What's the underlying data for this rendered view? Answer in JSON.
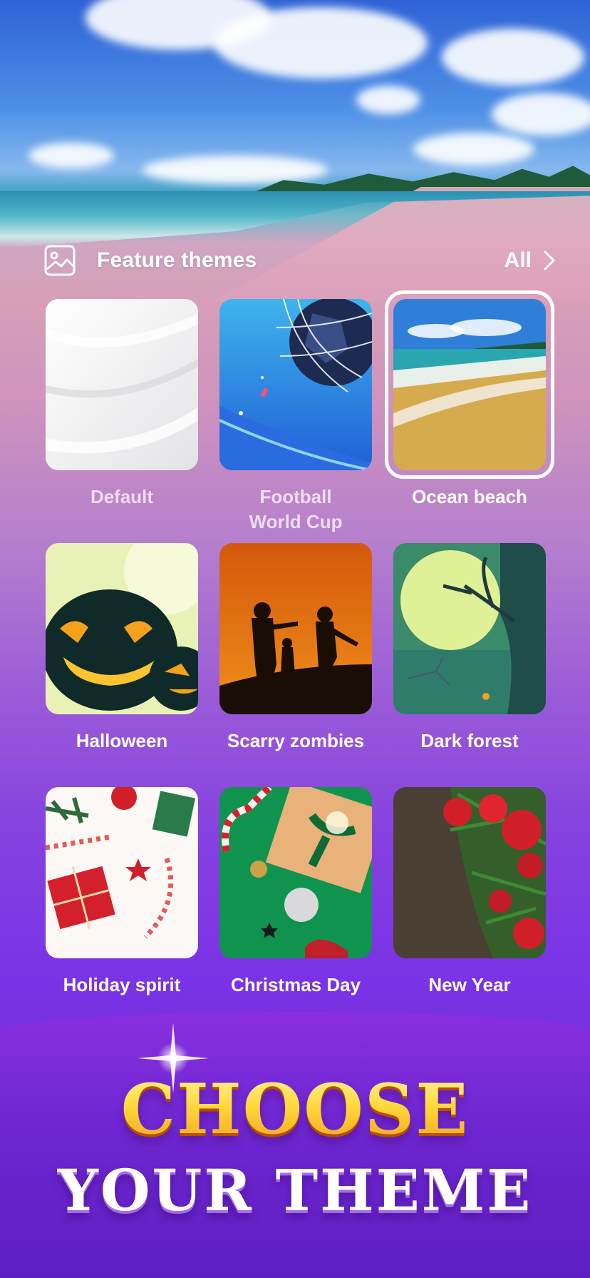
{
  "header": {
    "title": "Feature themes",
    "icon": "gallery-icon",
    "all_label": "All",
    "all_icon": "chevron-right-icon"
  },
  "themes": [
    {
      "label": "Default",
      "selected": false,
      "dim": true
    },
    {
      "label": "Football\nWorld Cup",
      "selected": false,
      "dim": true
    },
    {
      "label": "Ocean beach",
      "selected": true,
      "dim": false
    },
    {
      "label": "Halloween",
      "selected": false,
      "dim": false
    },
    {
      "label": "Scarry zombies",
      "selected": false,
      "dim": false
    },
    {
      "label": "Dark forest",
      "selected": false,
      "dim": false
    },
    {
      "label": "Holiday spirit",
      "selected": false,
      "dim": false
    },
    {
      "label": "Christmas Day",
      "selected": false,
      "dim": false
    },
    {
      "label": "New Year",
      "selected": false,
      "dim": false
    }
  ],
  "banner": {
    "line1": "CHOOSE",
    "line2": "YOUR THEME"
  },
  "colors": {
    "accent_gold": "#ffd53a",
    "purple": "#7a33e6"
  }
}
